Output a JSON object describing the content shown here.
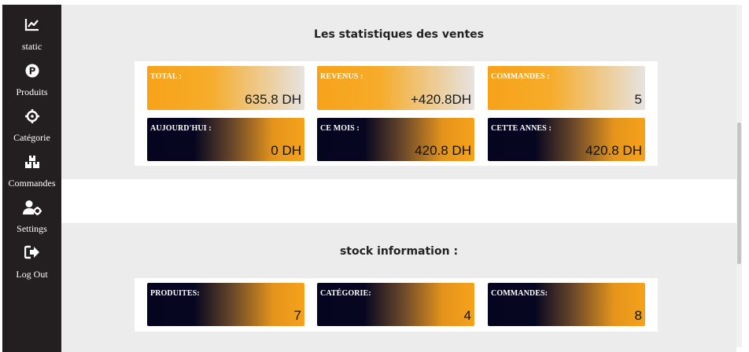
{
  "sidebar": {
    "items": [
      {
        "label": "static",
        "icon": "chart-line-icon"
      },
      {
        "label": "Produits",
        "icon": "product-p-icon"
      },
      {
        "label": "Catégorie",
        "icon": "crosshair-icon"
      },
      {
        "label": "Commandes",
        "icon": "boxes-icon"
      },
      {
        "label": "Settings",
        "icon": "user-gear-icon"
      },
      {
        "label": "Log Out",
        "icon": "sign-out-icon"
      }
    ]
  },
  "stats": {
    "title": "Les statistiques des ventes",
    "cards": [
      {
        "label": "TOTAL :",
        "value": "635.8 DH"
      },
      {
        "label": "REVENUS :",
        "value": "+420.8DH"
      },
      {
        "label": "COMMANDES :",
        "value": "5"
      },
      {
        "label": "AUJOURD'HUI :",
        "value": "0 DH"
      },
      {
        "label": "CE MOIS :",
        "value": "420.8 DH"
      },
      {
        "label": "CETTE ANNES :",
        "value": "420.8 DH"
      }
    ]
  },
  "stock": {
    "title": "stock information :",
    "cards": [
      {
        "label": "PRODUITES:",
        "value": "7"
      },
      {
        "label": "CATÉGORIE:",
        "value": "4"
      },
      {
        "label": "COMMANDES:",
        "value": "8"
      }
    ]
  },
  "colors": {
    "sidebar_bg": "#231f20",
    "accent_orange": "#f7a21a",
    "dark_navy": "#050520",
    "section_bg": "#ececec"
  }
}
